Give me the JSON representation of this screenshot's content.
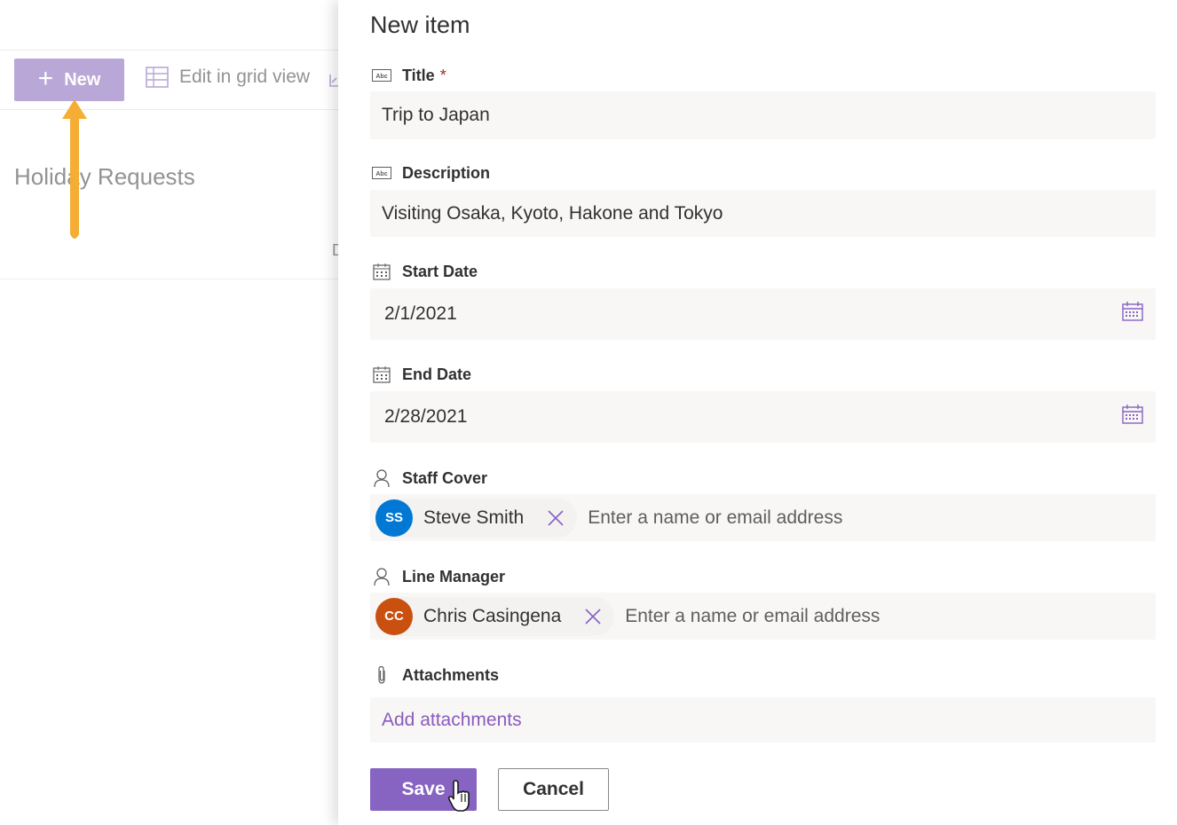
{
  "background": {
    "new_button_label": "New",
    "grid_view_label": "Edit in grid view",
    "list_title": "Holiday Requests",
    "column_header_partial": "D"
  },
  "panel": {
    "title": "New item",
    "fields": {
      "title": {
        "label": "Title",
        "required_mark": "*",
        "value": "Trip to Japan"
      },
      "description": {
        "label": "Description",
        "value": "Visiting Osaka, Kyoto, Hakone and Tokyo"
      },
      "start_date": {
        "label": "Start Date",
        "value": "2/1/2021"
      },
      "end_date": {
        "label": "End Date",
        "value": "2/28/2021"
      },
      "staff_cover": {
        "label": "Staff Cover",
        "person_initials": "SS",
        "person_name": "Steve Smith",
        "avatar_color": "#0078d4",
        "placeholder": "Enter a name or email address"
      },
      "line_manager": {
        "label": "Line Manager",
        "person_initials": "CC",
        "person_name": "Chris Casingena",
        "avatar_color": "#ca5010",
        "placeholder": "Enter a name or email address"
      },
      "attachments": {
        "label": "Attachments",
        "link": "Add attachments"
      }
    },
    "save_label": "Save",
    "cancel_label": "Cancel"
  },
  "colors": {
    "accent": "#8763c2",
    "new_button": "#b4a0d4",
    "arrow": "#f5a623",
    "field_bg": "#f8f7f6"
  }
}
